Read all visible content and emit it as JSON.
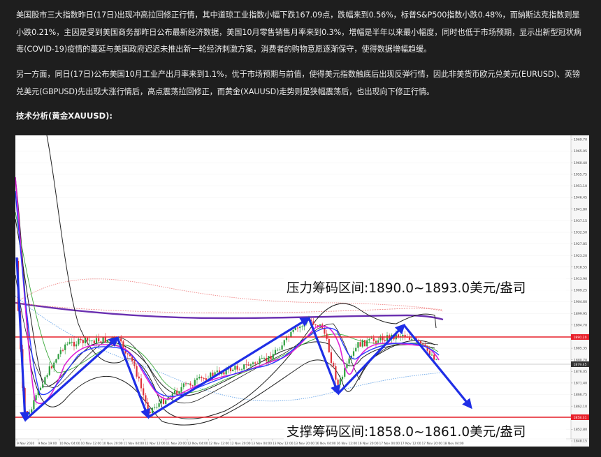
{
  "article": {
    "paragraph_1": "美国股市三大指数昨日(17日)出现冲高拉回修正行情，其中道琼工业指数小幅下跌167.09点，跌幅来到0.56%，标普S&P500指数小跌0.48%，而納斯达克指数则是小跌0.21%，主因是受到美国商务部昨日公布最新经济数据，美国10月零售销售月率来到0.3%，增幅是半年以来最小幅度，同时也低于市场预期，显示出新型冠状病毒(COVID-19)疫情的蔓延与美国政府迟迟未推出新一轮经济刺激方案，消费者的购物意愿逐渐保守，使得数据增幅趋缓。",
    "paragraph_2": "另一方面，同日(17日)公布美国10月工业产出月率来到1.1%，优于市场预期与前值，使得美元指数触底后出现反弹行情，因此非美货币欧元兑美元(EURUSD)、英镑兑美元(GBPUSD)先出现大涨行情后，高点震荡拉回修正，而黄金(XAUUSD)走势则是狭幅震荡后，也出现向下修正行情。",
    "heading": "技术分析(黄金XAUUSD):"
  },
  "chart": {
    "resistance_label": "压力筹码区间:1890.0~1893.0美元/盎司",
    "support_label": "支撑筹码区间:1858.0~1861.0美元/盎司",
    "price_ticks": [
      "1969.70",
      "1965.05",
      "1960.40",
      "1955.75",
      "1951.10",
      "1946.45",
      "1941.80",
      "1937.15",
      "1932.50",
      "1927.85",
      "1923.20",
      "1918.55",
      "1913.90",
      "1909.25",
      "1904.60",
      "1899.95",
      "1894.70",
      "1890.02",
      "1885.35",
      "1880.70",
      "1876.05",
      "1871.40",
      "1866.75",
      "1862.10",
      "1857.45",
      "1852.80",
      "1848.15"
    ],
    "current_price_tag": "1879.45",
    "resistance_tag": "1890.20",
    "support_tag": "1858.31",
    "time_ticks": [
      "9 Nov 2020",
      "9 Nov 19:00",
      "10 Nov 04:00",
      "10 Nov 12:00",
      "10 Nov 20:00",
      "11 Nov 04:00",
      "11 Nov 12:00",
      "11 Nov 20:00",
      "12 Nov 04:00",
      "12 Nov 12:00",
      "12 Nov 20:00",
      "13 Nov 04:00",
      "13 Nov 12:00",
      "13 Nov 20:00",
      "16 Nov 04:00",
      "16 Nov 12:00",
      "16 Nov 20:00",
      "17 Nov 04:00",
      "17 Nov 12:00",
      "17 Nov 20:00",
      "18 Nov 04:00"
    ],
    "colors": {
      "resistance_line": "#e8202a",
      "support_line": "#e8202a",
      "trend_arrows": "#1f2ee6",
      "bollinger": "#000000",
      "long_ma": "#6a2fb0",
      "ma_magenta": "#e020d8",
      "ma_blue": "#2b3bff",
      "ma_green": "#3aa83a",
      "bull_candle": "#2e9e3e",
      "bear_candle": "#e0303a"
    },
    "icons": [
      "arrow-head-icon"
    ]
  }
}
